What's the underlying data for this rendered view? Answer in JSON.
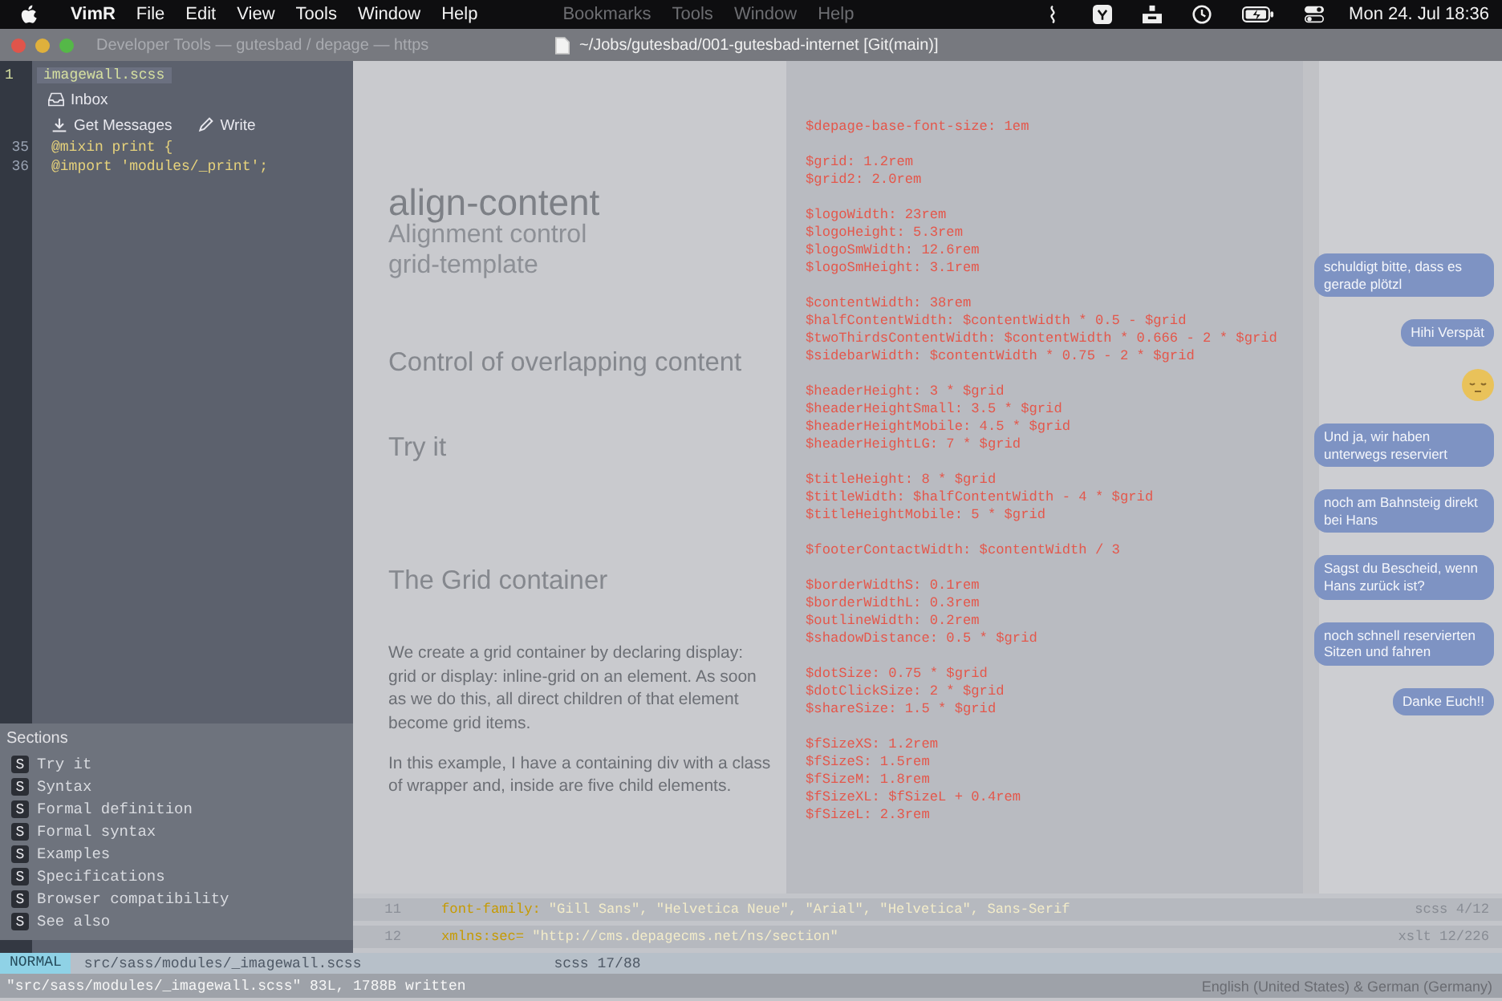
{
  "menu_bar": {
    "menus": [
      "VimR",
      "File",
      "Edit",
      "View",
      "Tools",
      "Window",
      "Help"
    ],
    "background_menus": [
      "Bookmarks",
      "Tools",
      "Window",
      "Help"
    ],
    "clock": "Mon 24. Jul 18:36"
  },
  "title_bar": {
    "tab_title": "Developer Tools — gutesbad / depage — https",
    "path": "~/Jobs/gutesbad/001-gutesbad-internet [Git(main)]"
  },
  "editor": {
    "buffer_number": "1",
    "file_name": "imagewall.scss",
    "folder": "Inbox",
    "mail_buttons": [
      "Get Messages",
      "Write"
    ],
    "lines": [
      {
        "number": "35",
        "text": "@mixin print {"
      },
      {
        "number": "36",
        "text": "@import 'modules/_print';"
      }
    ]
  },
  "sections": {
    "title": "Sections",
    "items": [
      {
        "badge": "S",
        "label": "Try it"
      },
      {
        "badge": "S",
        "label": "Syntax"
      },
      {
        "badge": "S",
        "label": "Formal definition"
      },
      {
        "badge": "S",
        "label": "Formal syntax"
      },
      {
        "badge": "S",
        "label": "Examples"
      },
      {
        "badge": "S",
        "label": "Specifications"
      },
      {
        "badge": "S",
        "label": "Browser compatibility"
      },
      {
        "badge": "S",
        "label": "See also"
      }
    ]
  },
  "article": {
    "blocks": [
      {
        "kind": "title",
        "text": "align-content"
      },
      {
        "kind": "subheading",
        "text": "Alignment control"
      },
      {
        "kind": "subheading",
        "text": "grid-template"
      },
      {
        "kind": "heading",
        "text": "Control of overlapping content"
      },
      {
        "kind": "heading",
        "text": "Try it"
      },
      {
        "kind": "heading",
        "text": "The Grid container"
      },
      {
        "kind": "paragraph",
        "text": "We create a grid container by declaring display: grid or display: inline-grid on an element. As soon as we do this, all direct children of that element become grid items."
      },
      {
        "kind": "paragraph",
        "text": "In this example, I have a containing div with a class of wrapper and, inside are five child elements."
      }
    ]
  },
  "code_pane": {
    "blocks": [
      [
        "$depage-base-font-size: 1em"
      ],
      [
        "$grid: 1.2rem",
        "$grid2: 2.0rem"
      ],
      [
        "$logoWidth: 23rem",
        "$logoHeight: 5.3rem",
        "$logoSmWidth: 12.6rem",
        "$logoSmHeight: 3.1rem"
      ],
      [
        "$contentWidth: 38rem",
        "$halfContentWidth: $contentWidth * 0.5 - $grid",
        "$twoThirdsContentWidth: $contentWidth * 0.666 - 2 * $grid",
        "$sidebarWidth: $contentWidth * 0.75 - 2 * $grid"
      ],
      [
        "$headerHeight: 3 * $grid",
        "$headerHeightSmall: 3.5 * $grid",
        "$headerHeightMobile: 4.5 * $grid",
        "$headerHeightLG: 7 * $grid"
      ],
      [
        "$titleHeight: 8 * $grid",
        "$titleWidth: $halfContentWidth - 4 * $grid",
        "$titleHeightMobile: 5 * $grid"
      ],
      [
        "$footerContactWidth: $contentWidth / 3"
      ],
      [
        "$borderWidthS: 0.1rem",
        "$borderWidthL: 0.3rem",
        "$outlineWidth: 0.2rem",
        "$shadowDistance: 0.5 * $grid"
      ],
      [
        "$dotSize: 0.75 * $grid",
        "$dotClickSize: 2 * $grid",
        "$shareSize: 1.5 * $grid"
      ],
      [
        "$fSizeXS: 1.2rem",
        "$fSizeS: 1.5rem",
        "$fSizeM: 1.8rem",
        "$fSizeXL: $fSizeL + 0.4rem",
        "$fSizeL: 2.3rem"
      ]
    ]
  },
  "chat": {
    "messages": [
      {
        "kind": "text",
        "text": "schuldigt bitte, dass es gerade plötzl"
      },
      {
        "kind": "text",
        "text": "Hihi Verspät"
      },
      {
        "kind": "sticker"
      },
      {
        "kind": "text",
        "text": "Und ja, wir haben unterwegs reserviert"
      },
      {
        "kind": "text",
        "text": "noch am Bahnsteig direkt bei Hans"
      },
      {
        "kind": "text",
        "text": "Sagst du Bescheid, wenn Hans zurück ist?"
      },
      {
        "kind": "text",
        "text": "noch schnell reservierten Sitzen und fahren"
      },
      {
        "kind": "text",
        "text": "Danke Euch!!"
      }
    ]
  },
  "splits": [
    {
      "line_number": "11",
      "property": "font-family:",
      "value": "\"Gill Sans\", \"Helvetica Neue\", \"Arial\", \"Helvetica\", Sans-Serif",
      "position": "scss 4/12"
    },
    {
      "line_number": "12",
      "property": "xmlns:sec=",
      "value": "\"http://cms.depagecms.net/ns/section\"",
      "position": "xslt 12/226"
    }
  ],
  "status_line": {
    "mode": "NORMAL",
    "file": "src/sass/modules/_imagewall.scss",
    "position": "scss 17/88"
  },
  "command_line": {
    "message": "\"src/sass/modules/_imagewall.scss\" 83L, 1788B written",
    "input_sources": "English (United States) & German (Germany)"
  }
}
